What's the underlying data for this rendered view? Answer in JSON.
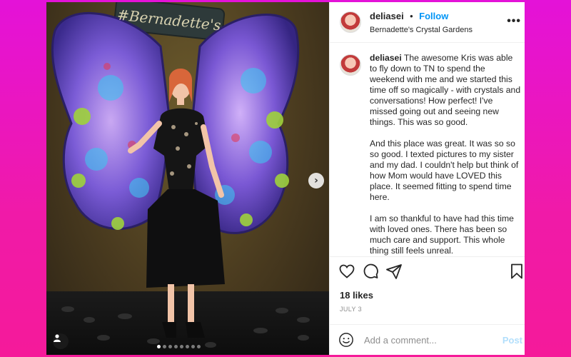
{
  "background": {
    "gradient_top": "#e412d8",
    "gradient_bottom": "#f51a9a"
  },
  "photo": {
    "sign_text": "#Bernadette's",
    "carousel_index": 1,
    "carousel_count": 8,
    "next_icon": "chevron-right-icon",
    "tag_icon": "user-tag-icon"
  },
  "header": {
    "username": "deliasei",
    "separator": "•",
    "follow_label": "Follow",
    "location": "Bernadette's Crystal Gardens",
    "more_icon": "more-horizontal-icon",
    "more_label": "•••"
  },
  "caption": {
    "username": "deliasei",
    "paragraphs": [
      "The awesome Kris was able to fly down to TN to spend the weekend with me and we started this time off so magically - with crystals and conversations! How perfect! I've missed going out and seeing new things. This was so good.",
      "And this place was great. It was so so so good. I texted pictures to my sister and my dad. I couldn't help but think of how Mom would have LOVED this place. It seemed fitting to spend time here.",
      "I am so thankful to have had this time with loved ones. There has been so much care and support. This whole thing still feels unreal."
    ]
  },
  "actions": {
    "icons": [
      "heart-icon",
      "comment-icon",
      "share-icon",
      "bookmark-icon"
    ]
  },
  "likes": "18 likes",
  "date": "JULY 3",
  "comment": {
    "placeholder": "Add a comment...",
    "post_label": "Post",
    "emoji_icon": "emoji-icon"
  },
  "colors": {
    "link_blue": "#0095f6",
    "post_disabled": "#b2dffc",
    "text": "#262626",
    "muted": "#8e8e8e"
  }
}
